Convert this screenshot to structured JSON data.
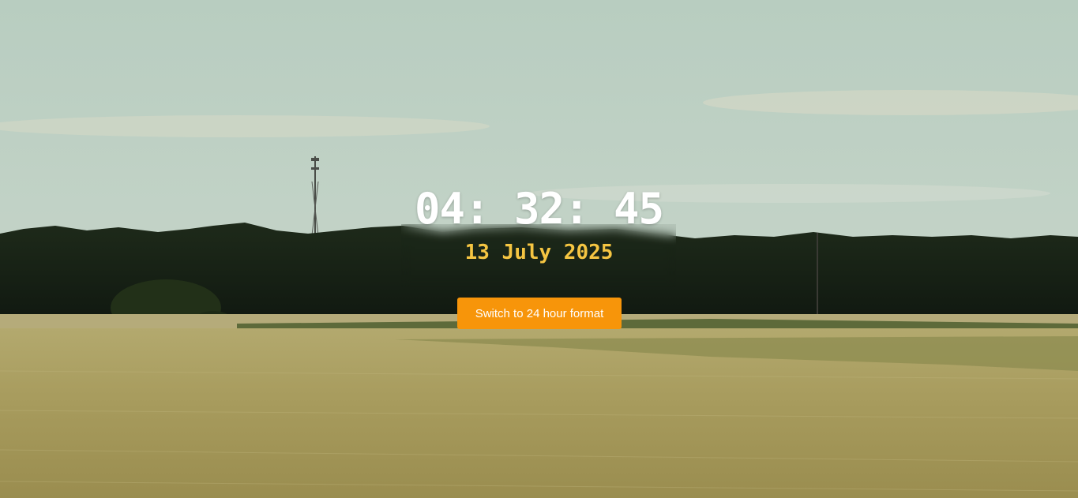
{
  "clock": {
    "time": "04: 32: 45",
    "date": "13 July 2025"
  },
  "controls": {
    "toggle_label": "Switch to 24 hour format"
  },
  "colors": {
    "time_text": "#ffffff",
    "date_text": "#f5c542",
    "button_bg": "#f7950a"
  },
  "background": {
    "scene": "wheat-field-landscape"
  }
}
